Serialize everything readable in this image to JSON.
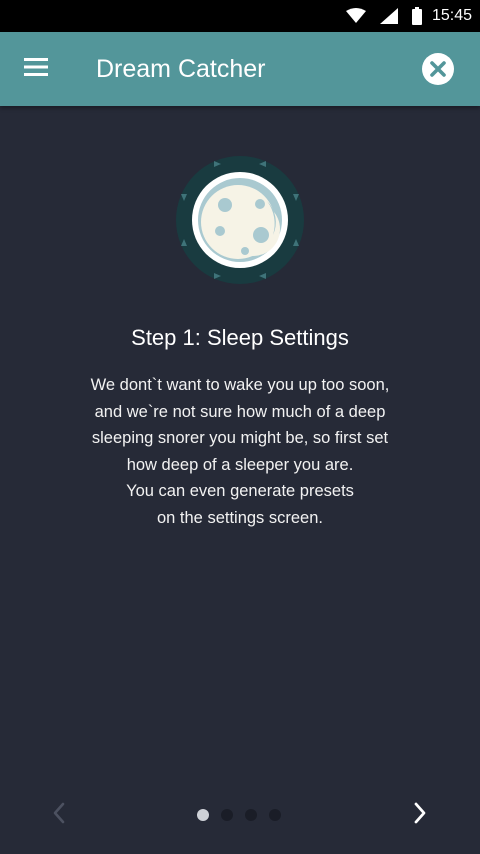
{
  "status_bar": {
    "time": "15:45",
    "icons": [
      "wifi-icon",
      "signal-icon",
      "battery-icon"
    ]
  },
  "app_bar": {
    "title": "Dream Catcher",
    "menu_icon": "hamburger-menu-icon",
    "close_icon": "close-circle-icon",
    "background": "#53969a"
  },
  "content": {
    "illustration_icon": "moon-icon",
    "step_title": "Step 1: Sleep Settings",
    "description_lines": [
      "We dont`t want to wake you up too soon,",
      "and we`re not sure how much of a deep",
      "sleeping snorer you might be, so first set",
      "how deep of a sleeper you are.",
      "You can even generate presets",
      "on the settings screen."
    ]
  },
  "pager": {
    "total": 4,
    "current": 1,
    "prev_icon": "chevron-left-icon",
    "next_icon": "chevron-right-icon"
  },
  "colors": {
    "background": "#262a37",
    "accent": "#53969a",
    "moon": "#f6f3e6"
  }
}
